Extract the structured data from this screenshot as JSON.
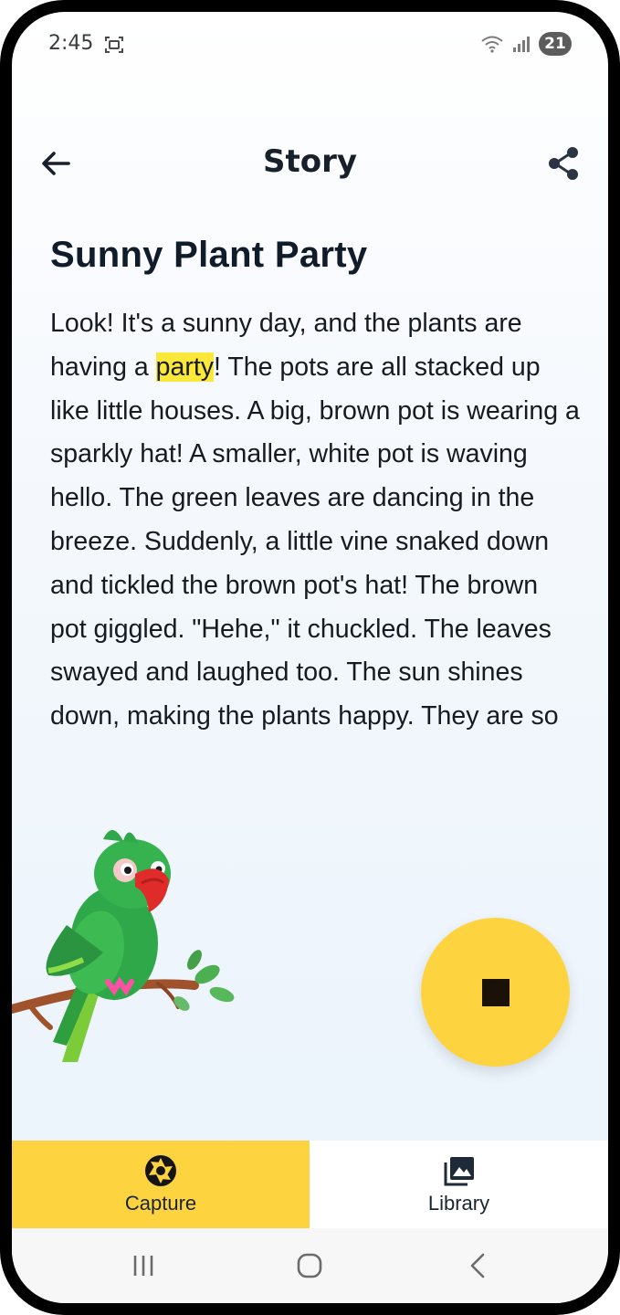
{
  "status_bar": {
    "time": "2:45",
    "battery": "21",
    "icons": [
      "screenshot-icon",
      "wifi-icon",
      "signal-icon",
      "battery-icon"
    ]
  },
  "app_bar": {
    "title": "Story",
    "back_icon": "arrow-left-icon",
    "share_icon": "share-icon"
  },
  "story": {
    "title": "Sunny Plant Party",
    "body_before": "Look! It's a sunny day, and the plants are having a ",
    "highlighted_word": "party",
    "body_after": "! The pots are all stacked up like little houses. A big, brown pot is wearing a sparkly hat! A smaller, white pot is waving hello. The green leaves are dancing in the breeze. Suddenly, a little vine snaked down and tickled the brown pot's hat! The brown pot giggled. \"Hehe,\" it chuckled. The leaves swayed and laughed too. The sun shines down, making the plants happy. They are so",
    "highlight_color": "#fbe83a"
  },
  "fab": {
    "icon": "stop-icon",
    "color": "#fdd43f"
  },
  "bottom_nav": {
    "items": [
      {
        "label": "Capture",
        "icon": "camera-aperture-icon",
        "active": true
      },
      {
        "label": "Library",
        "icon": "photo-library-icon",
        "active": false
      }
    ],
    "active_color": "#fdd43f"
  },
  "system_nav": {
    "icons": [
      "recent-apps-icon",
      "home-icon",
      "back-icon"
    ]
  }
}
